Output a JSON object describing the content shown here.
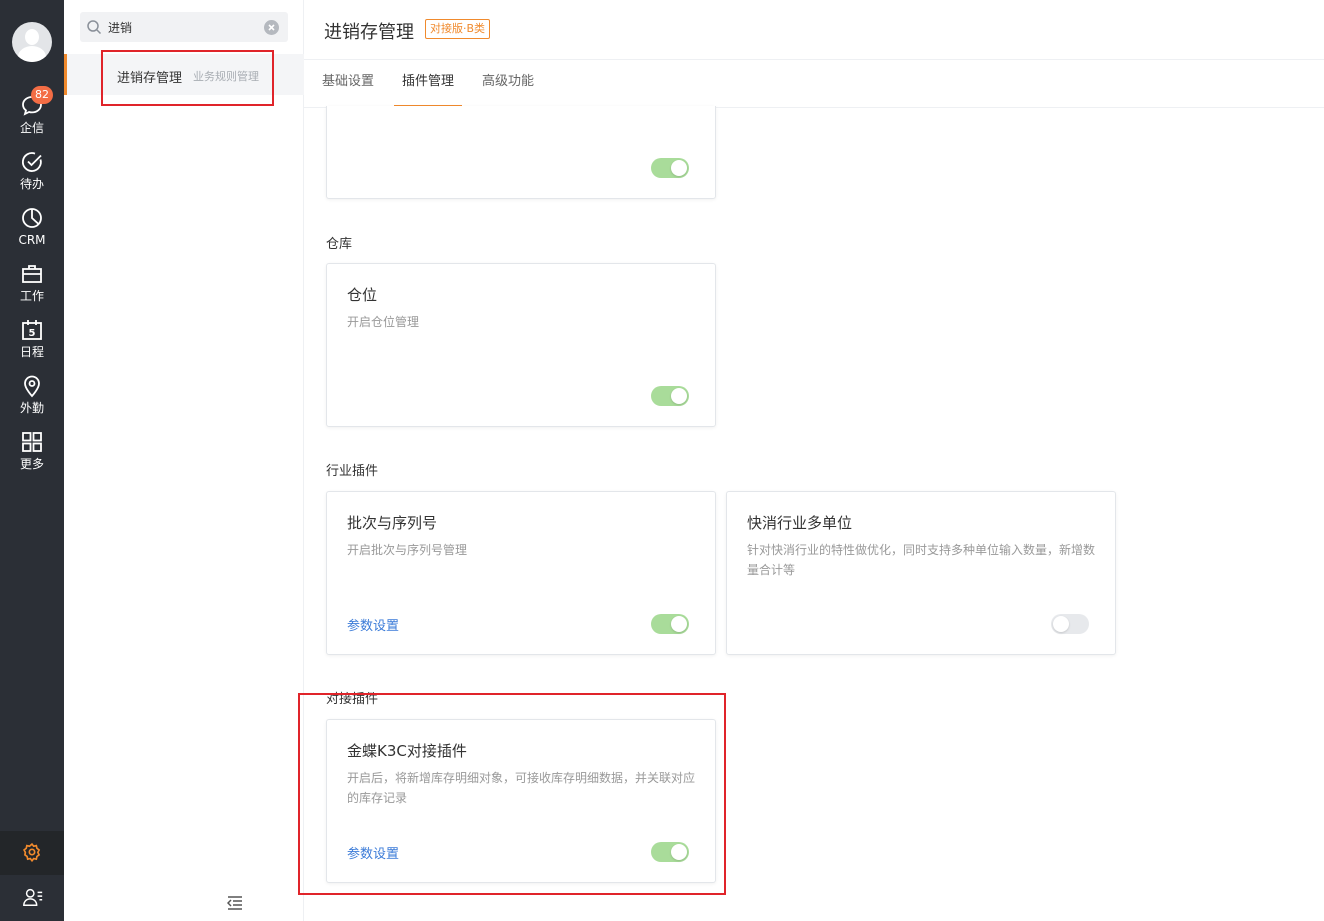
{
  "rail": {
    "badge_count": "82",
    "items": [
      {
        "label": "企信",
        "icon": "chat-bubble-icon"
      },
      {
        "label": "待办",
        "icon": "check-circle-icon"
      },
      {
        "label": "CRM",
        "icon": "pie-chart-icon"
      },
      {
        "label": "工作",
        "icon": "briefcase-icon"
      },
      {
        "label": "日程",
        "icon": "calendar-icon",
        "day": "5"
      },
      {
        "label": "外勤",
        "icon": "map-pin-icon"
      },
      {
        "label": "更多",
        "icon": "grid-icon"
      }
    ],
    "settings_icon": "gear-icon",
    "user_icon": "user-list-icon"
  },
  "search": {
    "value": "进销",
    "result_name": "进销存管理",
    "result_sub": "业务规则管理"
  },
  "header": {
    "title": "进销存管理",
    "tag": "对接版·B类"
  },
  "tabs": [
    {
      "label": "基础设置",
      "active": false
    },
    {
      "label": "插件管理",
      "active": true
    },
    {
      "label": "高级功能",
      "active": false
    }
  ],
  "sections": {
    "warehouse": "仓库",
    "industry": "行业插件",
    "docking": "对接插件"
  },
  "cards": {
    "top": {
      "on": true
    },
    "location": {
      "title": "仓位",
      "desc": "开启仓位管理",
      "on": true
    },
    "batch": {
      "title": "批次与序列号",
      "desc": "开启批次与序列号管理",
      "param": "参数设置",
      "on": true
    },
    "multiunit": {
      "title": "快消行业多单位",
      "desc": "针对快消行业的特性做优化，同时支持多种单位输入数量，新增数量合计等",
      "on": false
    },
    "k3c": {
      "title": "金蝶K3C对接插件",
      "desc": "开启后，将新增库存明细对象，可接收库存明细数据，并关联对应的库存记录",
      "param": "参数设置",
      "on": true
    }
  },
  "colors": {
    "accent": "#f08a2d",
    "rail_bg": "#2b2f36",
    "toggle_on": "#a9dc9a",
    "link": "#3b7bd8",
    "highlight": "#e0242a"
  }
}
